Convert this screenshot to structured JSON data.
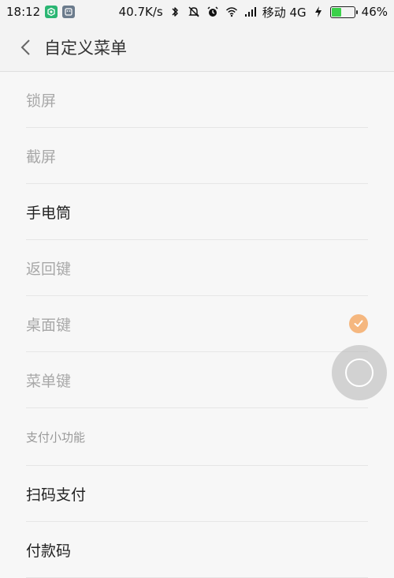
{
  "status_bar": {
    "time": "18:12",
    "network_speed": "40.7K/s",
    "carrier": "移动 4G",
    "battery_percent": "46%",
    "battery_level": 0.46,
    "icons": [
      "app-green-icon",
      "app-gray-icon",
      "bluetooth-icon",
      "mute-icon",
      "alarm-icon",
      "wifi-icon",
      "signal-icon",
      "charging-icon",
      "battery-icon"
    ]
  },
  "header": {
    "title": "自定义菜单"
  },
  "menu": {
    "items": [
      {
        "label": "锁屏",
        "enabled": false
      },
      {
        "label": "截屏",
        "enabled": false
      },
      {
        "label": "手电筒",
        "enabled": true
      },
      {
        "label": "返回键",
        "enabled": false
      },
      {
        "label": "桌面键",
        "enabled": false,
        "checked": true
      },
      {
        "label": "菜单键",
        "enabled": false
      }
    ],
    "section_title": "支付小功能",
    "pay_items": [
      {
        "label": "扫码支付",
        "enabled": true
      },
      {
        "label": "付款码",
        "enabled": true
      }
    ]
  },
  "colors": {
    "check_badge": "#f5b77f",
    "disabled_text": "#a8a8a8",
    "enabled_text": "#222222",
    "battery_fill": "#3bd14a"
  }
}
